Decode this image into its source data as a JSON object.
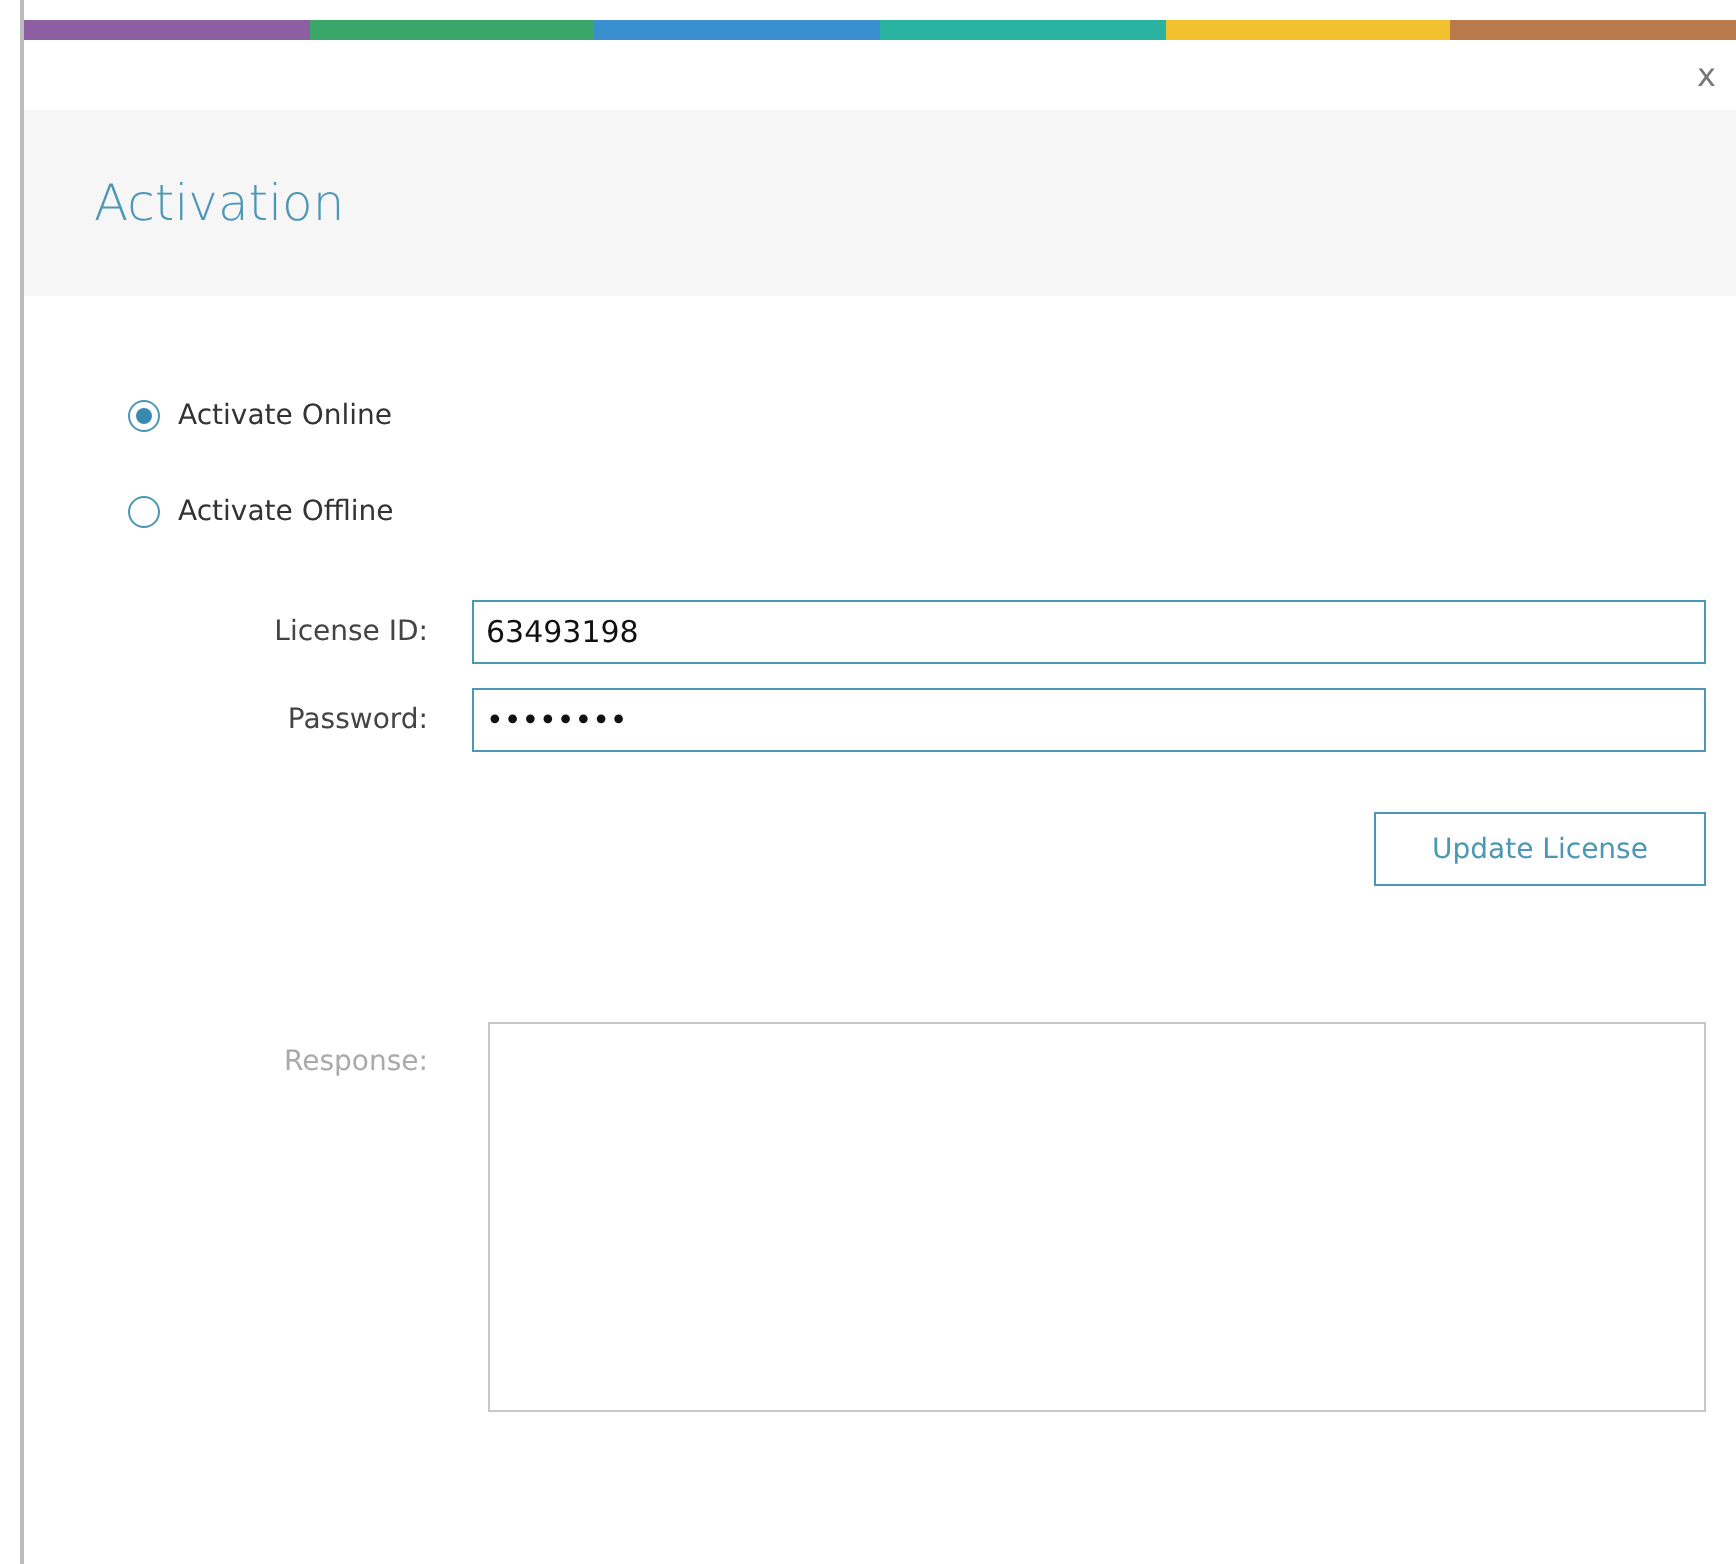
{
  "accent_stripe": [
    {
      "color": "#8e5ea2"
    },
    {
      "color": "#3aa66a"
    },
    {
      "color": "#3a8fcf"
    },
    {
      "color": "#2ab3a0"
    },
    {
      "color": "#f2c12e"
    },
    {
      "color": "#b97a4c"
    }
  ],
  "close_button": "x",
  "title": "Activation",
  "modes": [
    {
      "label": "Activate Online",
      "selected": true
    },
    {
      "label": "Activate Offline",
      "selected": false
    }
  ],
  "fields": [
    {
      "label": "License ID:",
      "value": "63493198"
    },
    {
      "label": "Password:",
      "value": "••••••••"
    }
  ],
  "update_button": "Update License",
  "response": {
    "label": "Response:",
    "disabled": true
  }
}
